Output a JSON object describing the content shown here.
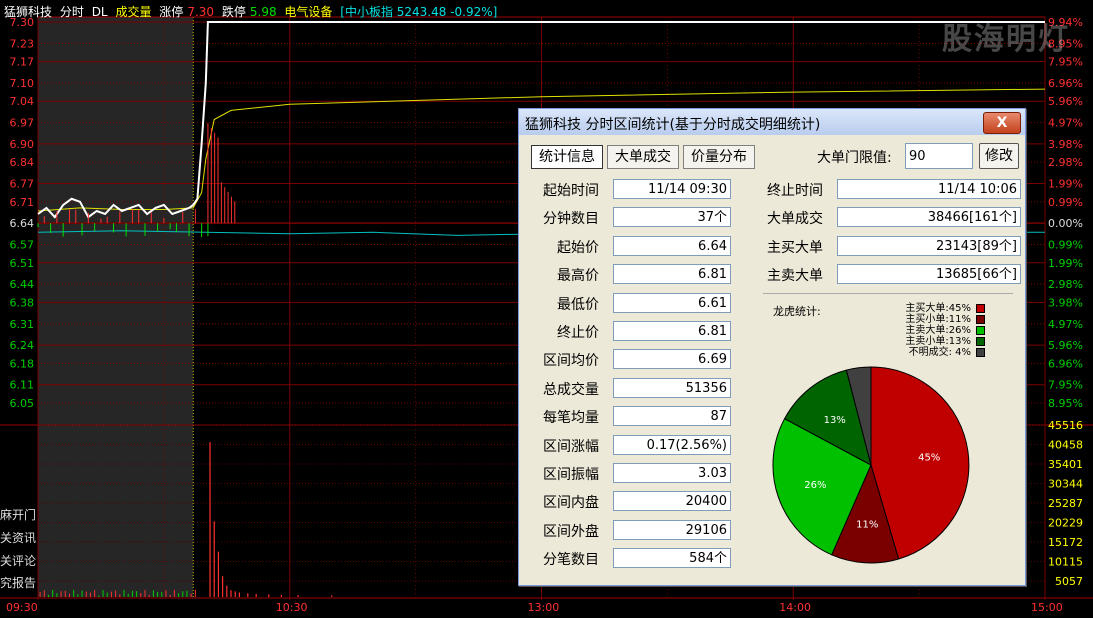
{
  "header": {
    "stock_name": "猛狮科技",
    "mode": "分时",
    "dl": "DL",
    "volume_label": "成交量",
    "limit_up_label": "涨停",
    "limit_up_value": "7.30",
    "limit_down_label": "跌停",
    "limit_down_value": "5.98",
    "sector": "电气设备",
    "index_text": "[中小板指 5243.48 -0.92%]"
  },
  "watermark": "股海明灯",
  "side_labels": [
    "麻开门",
    "关资讯",
    "关评论",
    "究报告"
  ],
  "chart_data": {
    "type": "line",
    "price_ticks": [
      "7.30",
      "7.23",
      "7.17",
      "7.10",
      "7.04",
      "6.97",
      "6.90",
      "6.84",
      "6.77",
      "6.71",
      "6.64",
      "6.57",
      "6.51",
      "6.44",
      "6.38",
      "6.31",
      "6.24",
      "6.18",
      "6.11",
      "6.05"
    ],
    "pct_ticks": [
      "9.94%",
      "8.95%",
      "7.95%",
      "6.96%",
      "5.96%",
      "4.97%",
      "3.98%",
      "2.98%",
      "1.99%",
      "0.99%",
      "0.00%",
      "0.99%",
      "1.99%",
      "2.98%",
      "3.98%",
      "4.97%",
      "5.96%",
      "6.96%",
      "7.95%",
      "8.95%"
    ],
    "volume_ticks": [
      "45516",
      "40458",
      "35401",
      "30344",
      "25287",
      "20229",
      "15172",
      "10115",
      "5057"
    ],
    "time_ticks": [
      "09:30",
      "10:30",
      "13:00",
      "14:00",
      "15:00"
    ],
    "prev_close": 6.64,
    "price_range": [
      6.05,
      7.3
    ],
    "volume_range": [
      0,
      45516
    ],
    "price_series": [
      {
        "t": 0,
        "p": 6.67
      },
      {
        "t": 2,
        "p": 6.69
      },
      {
        "t": 4,
        "p": 6.66
      },
      {
        "t": 6,
        "p": 6.7
      },
      {
        "t": 8,
        "p": 6.72
      },
      {
        "t": 10,
        "p": 6.71
      },
      {
        "t": 12,
        "p": 6.66
      },
      {
        "t": 14,
        "p": 6.68
      },
      {
        "t": 16,
        "p": 6.67
      },
      {
        "t": 18,
        "p": 6.7
      },
      {
        "t": 20,
        "p": 6.68
      },
      {
        "t": 22,
        "p": 6.69
      },
      {
        "t": 24,
        "p": 6.7
      },
      {
        "t": 26,
        "p": 6.67
      },
      {
        "t": 28,
        "p": 6.69
      },
      {
        "t": 30,
        "p": 6.7
      },
      {
        "t": 32,
        "p": 6.67
      },
      {
        "t": 34,
        "p": 6.68
      },
      {
        "t": 36,
        "p": 6.69
      },
      {
        "t": 37,
        "p": 6.7
      },
      {
        "t": 38,
        "p": 6.72
      },
      {
        "t": 39,
        "p": 6.9
      },
      {
        "t": 40,
        "p": 7.1
      },
      {
        "t": 40.5,
        "p": 7.3
      },
      {
        "t": 240,
        "p": 7.3
      }
    ],
    "avg_series": [
      {
        "t": 0,
        "p": 6.68
      },
      {
        "t": 10,
        "p": 6.69
      },
      {
        "t": 20,
        "p": 6.685
      },
      {
        "t": 30,
        "p": 6.685
      },
      {
        "t": 37,
        "p": 6.69
      },
      {
        "t": 39,
        "p": 6.74
      },
      {
        "t": 40,
        "p": 6.85
      },
      {
        "t": 42,
        "p": 6.98
      },
      {
        "t": 46,
        "p": 7.01
      },
      {
        "t": 60,
        "p": 7.03
      },
      {
        "t": 120,
        "p": 7.055
      },
      {
        "t": 180,
        "p": 7.07
      },
      {
        "t": 240,
        "p": 7.08
      }
    ],
    "index_series": [
      {
        "t": 0,
        "p": 6.61
      },
      {
        "t": 20,
        "p": 6.615
      },
      {
        "t": 40,
        "p": 6.61
      },
      {
        "t": 60,
        "p": 6.605
      },
      {
        "t": 80,
        "p": 6.61
      },
      {
        "t": 100,
        "p": 6.6
      },
      {
        "t": 120,
        "p": 6.605
      },
      {
        "t": 140,
        "p": 6.615
      },
      {
        "t": 160,
        "p": 6.62
      },
      {
        "t": 180,
        "p": 6.615
      },
      {
        "t": 200,
        "p": 6.61
      },
      {
        "t": 220,
        "p": 6.61
      },
      {
        "t": 240,
        "p": 6.61
      }
    ],
    "volume_bars": [
      {
        "t": 41,
        "v": 41000
      },
      {
        "t": 42,
        "v": 20000
      },
      {
        "t": 43,
        "v": 12000
      },
      {
        "t": 44,
        "v": 5500
      },
      {
        "t": 45,
        "v": 3000
      },
      {
        "t": 46,
        "v": 1800
      },
      {
        "t": 47,
        "v": 1500
      },
      {
        "t": 48,
        "v": 1200
      },
      {
        "t": 50,
        "v": 1000
      },
      {
        "t": 52,
        "v": 800
      },
      {
        "t": 55,
        "v": 700
      },
      {
        "t": 58,
        "v": 600
      },
      {
        "t": 62,
        "v": 500
      },
      {
        "t": 70,
        "v": 400
      }
    ]
  },
  "dialog": {
    "title": "猛狮科技 分时区间统计(基于分时成交明细统计)",
    "close": "X",
    "tabs": [
      "统计信息",
      "大单成交",
      "价量分布"
    ],
    "threshold_label": "大单门限值:",
    "threshold_value": "90",
    "modify_button": "修改",
    "left_rows": [
      {
        "label": "起始时间",
        "value": "11/14 09:30"
      },
      {
        "label": "分钟数目",
        "value": "37个"
      },
      {
        "label": "起始价",
        "value": "6.64"
      },
      {
        "label": "最高价",
        "value": "6.81"
      },
      {
        "label": "最低价",
        "value": "6.61"
      },
      {
        "label": "终止价",
        "value": "6.81"
      },
      {
        "label": "区间均价",
        "value": "6.69"
      },
      {
        "label": "总成交量",
        "value": "51356"
      },
      {
        "label": "每笔均量",
        "value": "87"
      },
      {
        "label": "区间涨幅",
        "value": "0.17(2.56%)"
      },
      {
        "label": "区间振幅",
        "value": "3.03"
      },
      {
        "label": "区间内盘",
        "value": "20400"
      },
      {
        "label": "区间外盘",
        "value": "29106"
      },
      {
        "label": "分笔数目",
        "value": "584个"
      }
    ],
    "right_rows": [
      {
        "label": "终止时间",
        "value": "11/14 10:06"
      },
      {
        "label": "大单成交",
        "value": "38466[161个]"
      },
      {
        "label": "主买大单",
        "value": "23143[89个]"
      },
      {
        "label": "主卖大单",
        "value": "13685[66个]"
      }
    ],
    "pie_title": "龙虎统计:",
    "pie_legend": [
      {
        "text": "主买大单:45%",
        "color": "#c00000"
      },
      {
        "text": "主买小单:11%",
        "color": "#7a0000"
      },
      {
        "text": "主卖大单:26%",
        "color": "#00c000"
      },
      {
        "text": "主卖小单:13%",
        "color": "#006400"
      },
      {
        "text": "不明成交: 4%",
        "color": "#404040"
      }
    ],
    "pie": [
      {
        "name": "主买大单",
        "value": 45,
        "label": "45%",
        "color": "#c00000"
      },
      {
        "name": "主买小单",
        "value": 11,
        "label": "11%",
        "color": "#7a0000"
      },
      {
        "name": "主卖大单",
        "value": 26,
        "label": "26%",
        "color": "#00c000"
      },
      {
        "name": "主卖小单",
        "value": 13,
        "label": "13%",
        "color": "#006400"
      },
      {
        "name": "不明成交",
        "value": 4,
        "label": "",
        "color": "#404040"
      }
    ]
  }
}
